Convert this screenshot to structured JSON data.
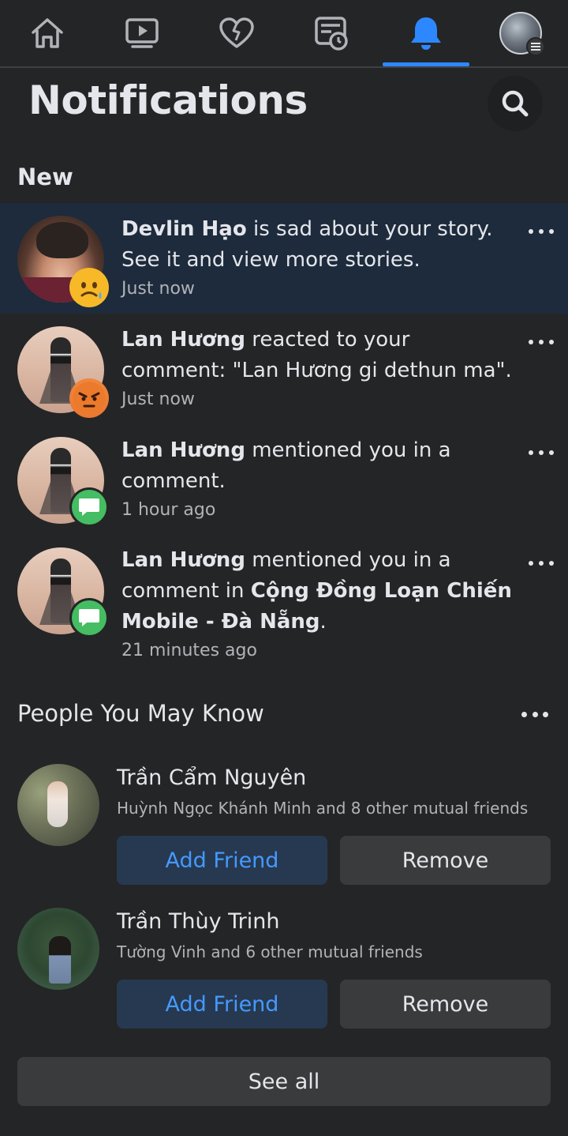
{
  "nav": {
    "items": [
      {
        "name": "home",
        "icon": "home-icon"
      },
      {
        "name": "watch",
        "icon": "video-icon"
      },
      {
        "name": "dating",
        "icon": "heart-icon"
      },
      {
        "name": "feeds",
        "icon": "news-feed-icon"
      },
      {
        "name": "notifications",
        "icon": "bell-icon",
        "active": true
      },
      {
        "name": "profile",
        "icon": "avatar"
      }
    ],
    "active_color": "#2d88ff"
  },
  "header": {
    "title": "Notifications",
    "search_icon": "search-icon"
  },
  "new_section": {
    "label": "New",
    "notifications": [
      {
        "actor": "Devlin Hạo",
        "text": " is sad about your story. See it and view more stories.",
        "time": "Just now",
        "reaction": "sad",
        "unread": true
      },
      {
        "actor": "Lan Hương",
        "text": " reacted to your comment: \"Lan Hương gi dethun ma\".",
        "time": "Just now",
        "reaction": "angry",
        "unread": false
      },
      {
        "actor": "Lan Hương",
        "text": " mentioned you in a comment.",
        "time": "1 hour ago",
        "reaction": "comment",
        "unread": false
      },
      {
        "actor": "Lan Hương",
        "text_before": " mentioned you in a comment in ",
        "group": "Cộng Đồng Loạn Chiến Mobile - Đà Nẵng",
        "text_after": ".",
        "time": "21 minutes ago",
        "reaction": "comment",
        "unread": false
      }
    ]
  },
  "pymk": {
    "label": "People You May Know",
    "people": [
      {
        "name": "Trần Cẩm Nguyên",
        "mutual": "Huỳnh Ngọc Khánh Minh and 8 other mutual friends",
        "add_label": "Add Friend",
        "remove_label": "Remove"
      },
      {
        "name": "Trần Thùy Trinh",
        "mutual": "Tường Vinh and 6 other mutual friends",
        "add_label": "Add Friend",
        "remove_label": "Remove"
      }
    ],
    "see_all": "See all"
  },
  "colors": {
    "background": "#242526",
    "unread_bg": "#263951",
    "primary_text": "#e4e6eb",
    "secondary_text": "#b0b3b8",
    "add_friend_text": "#4599ff",
    "comment_badge": "#45bd62"
  }
}
